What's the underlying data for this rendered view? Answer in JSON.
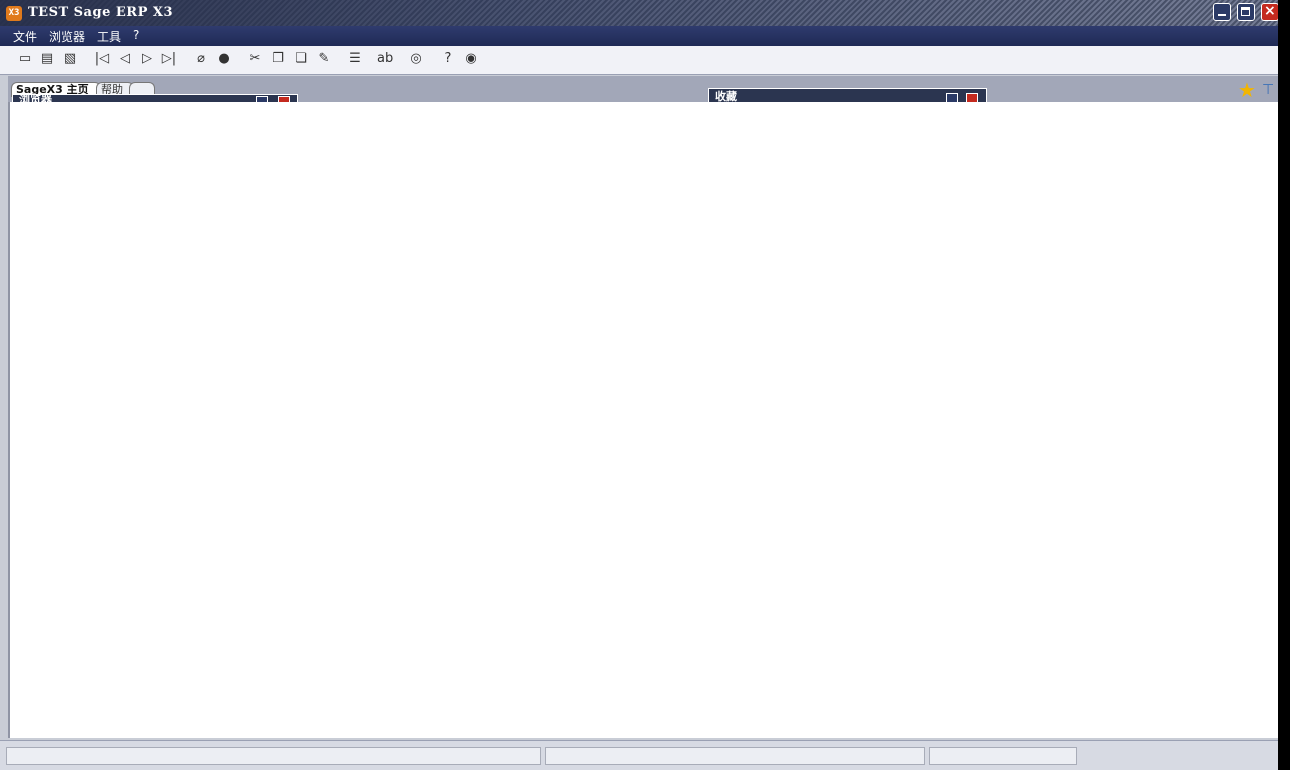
{
  "window": {
    "title": "TEST Sage ERP X3",
    "app_icon": "X3"
  },
  "menu": {
    "items": [
      "文件",
      "浏览器",
      "工具",
      "?"
    ]
  },
  "toolbar": {
    "icons": [
      "new-icon",
      "print-icon",
      "print-preview-icon",
      "first-record-icon",
      "prev-record-icon",
      "next-record-icon",
      "last-record-icon",
      "attach-icon",
      "help-icon",
      "cut-icon",
      "copy-icon",
      "paste-icon",
      "edit-icon",
      "report-icon",
      "text-field-icon",
      "options-icon",
      "question-icon",
      "search-globe-icon"
    ]
  },
  "tabs": [
    {
      "label": "SageX3 主页"
    },
    {
      "label": "帮助"
    },
    {
      "label": ""
    }
  ],
  "panels": {
    "browser_title": "浏览器",
    "favorites_title": "收藏"
  },
  "statusbar": {
    "field1": "",
    "field2": "",
    "field3": ""
  }
}
